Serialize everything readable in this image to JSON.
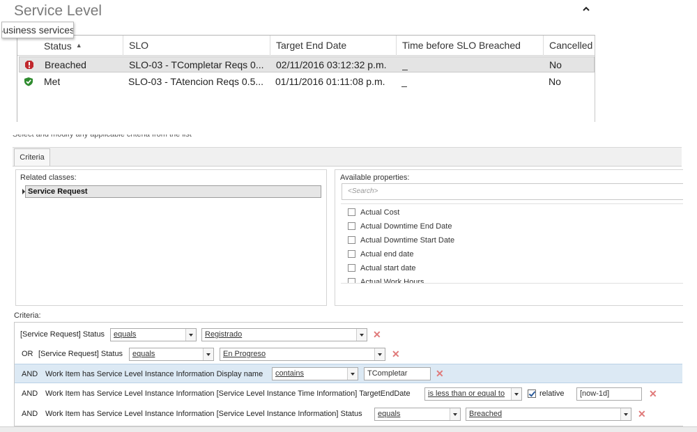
{
  "service_level": {
    "title": "Service Level",
    "tooltip": "Business services",
    "columns": [
      "Status",
      "SLO",
      "Target End Date",
      "Time before SLO Breached",
      "Cancelled"
    ],
    "rows": [
      {
        "status": "Breached",
        "slo": "SLO-03 - TCompletar Reqs 0...",
        "target": "02/11/2016 03:12:32 p.m.",
        "time": "_",
        "cancelled": "No",
        "icon": "breached-icon",
        "color": "#c0282d"
      },
      {
        "status": "Met",
        "slo": "SLO-03 - TAtencion Reqs 0.5...",
        "target": "01/11/2016 01:11:08 p.m.",
        "time": "_",
        "cancelled": "No",
        "icon": "met-icon",
        "color": "#2e8b2e"
      }
    ]
  },
  "editor": {
    "instructions": "Select and modify any applicable criteria from the list",
    "tab": "Criteria",
    "related_label": "Related classes:",
    "related_item": "Service Request",
    "available_label": "Available properties:",
    "search_placeholder": "<Search>",
    "properties": [
      "Actual Cost",
      "Actual Downtime End Date",
      "Actual Downtime Start Date",
      "Actual end date",
      "Actual start date",
      "Actual Work Hours"
    ],
    "criteria_label": "Criteria:"
  },
  "criteria": [
    {
      "connector": "",
      "field": "[Service Request] Status",
      "operator": "equals",
      "value": "Registrado"
    },
    {
      "connector": "OR",
      "field": "[Service Request] Status",
      "operator": "equals",
      "value": "En Progreso"
    },
    {
      "connector": "AND",
      "field": "Work Item has Service Level Instance Information Display name",
      "operator": "contains",
      "value": "TCompletar"
    },
    {
      "connector": "AND",
      "field": "Work Item has Service Level Instance Information [Service Level Instance Time Information] TargetEndDate",
      "operator": "is less than or equal to",
      "value": "[now-1d]",
      "relative_label": "relative"
    },
    {
      "connector": "AND",
      "field": "Work Item has Service Level Instance Information [Service Level Instance Information] Status",
      "operator": "equals",
      "value": "Breached"
    }
  ],
  "colors": {
    "highlight_row": "#dce9f4",
    "delete": "#e07a7a"
  }
}
